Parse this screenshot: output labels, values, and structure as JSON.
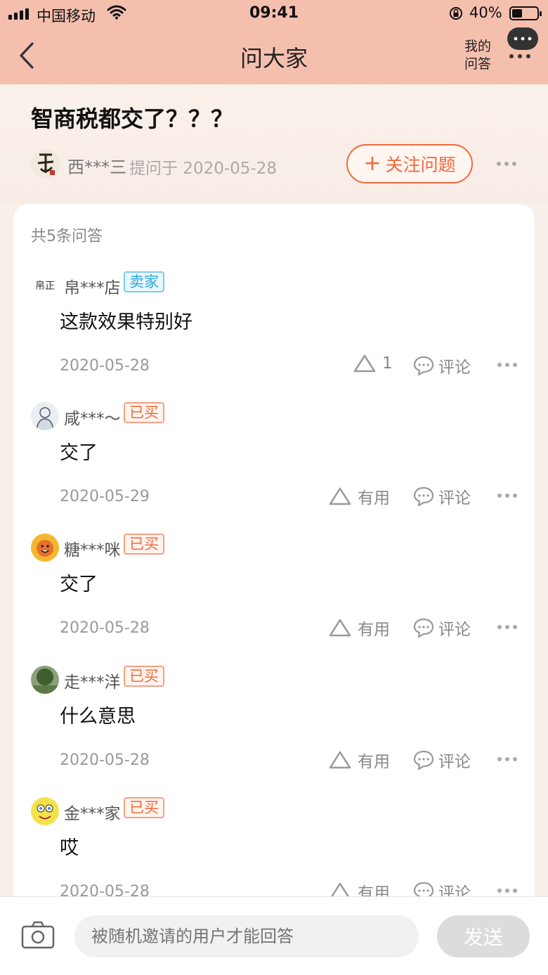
{
  "status_bar": {
    "carrier": "中国移动",
    "time": "09:41",
    "battery": "40%"
  },
  "nav": {
    "title": "问大家",
    "my_qa_line1": "我的",
    "my_qa_line2": "问答"
  },
  "question": {
    "title": "智商税都交了？？？",
    "asker": "西***三",
    "asked_at": "提问于 2020-05-28",
    "follow_label": "关注问题",
    "follow_plus": "+"
  },
  "answers_count": "共5条问答",
  "answers": [
    {
      "user": "帛***店",
      "badge": "卖家",
      "badge_type": "seller",
      "text": "这款效果特别好",
      "date": "2020-05-28",
      "useful": "1",
      "comment": "评论",
      "avatar": "shop-seal"
    },
    {
      "user": "咸***～",
      "badge": "已买",
      "badge_type": "bought",
      "text": "交了",
      "date": "2020-05-29",
      "useful": "有用",
      "comment": "评论",
      "avatar": "sketch-figure"
    },
    {
      "user": "糖***咪",
      "badge": "已买",
      "badge_type": "bought",
      "text": "交了",
      "date": "2020-05-28",
      "useful": "有用",
      "comment": "评论",
      "avatar": "cartoon-face"
    },
    {
      "user": "走***洋",
      "badge": "已买",
      "badge_type": "bought",
      "text": "什么意思",
      "date": "2020-05-28",
      "useful": "有用",
      "comment": "评论",
      "avatar": "tree-photo"
    },
    {
      "user": "金***家",
      "badge": "已买",
      "badge_type": "bought",
      "text": "哎",
      "date": "2020-05-28",
      "useful": "有用",
      "comment": "评论",
      "avatar": "sponge-cartoon"
    }
  ],
  "bottom_bar": {
    "input_placeholder": "被随机邀请的用户才能回答",
    "send_label": "发送"
  },
  "colors": {
    "accent": "#f06a3b",
    "header_bg": "#f5bfae",
    "seller_badge": "#29a8e0"
  }
}
